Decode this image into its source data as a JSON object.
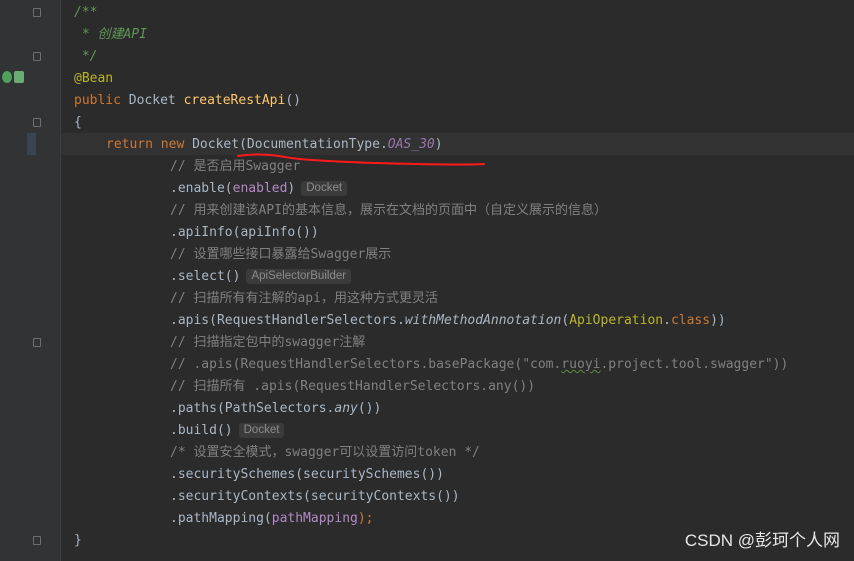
{
  "code": {
    "doc_open": "/**",
    "doc_body": " * 创建API",
    "doc_close": " */",
    "annotation": "@Bean",
    "sig_kw": "public ",
    "sig_type": "Docket ",
    "sig_fn": "createRestApi",
    "sig_paren": "()",
    "brace_open": "{",
    "ret_kw1": "return ",
    "ret_kw2": "new ",
    "ret_call": "Docket(DocumentationType.",
    "ret_const": "OAS_30",
    "ret_close": ")",
    "c1": "// 是否启用Swagger",
    "enable_a": ".enable(",
    "enable_p": "enabled",
    "enable_b": ")",
    "enable_hint": "Docket",
    "c2": "// 用来创建该API的基本信息，展示在文档的页面中（自定义展示的信息）",
    "apiinfo": ".apiInfo(apiInfo())",
    "c3": "// 设置哪些接口暴露给Swagger展示",
    "select": ".select()",
    "select_hint": "ApiSelectorBuilder",
    "c4": "// 扫描所有有注解的api，用这种方式更灵活",
    "apis_a": ".apis(RequestHandlerSelectors.",
    "apis_fn": "withMethodAnnotation",
    "apis_b": "(",
    "apis_cls": "ApiOperation",
    "apis_dot": ".",
    "apis_kw": "class",
    "apis_c": "))",
    "c5": "// 扫描指定包中的swagger注解",
    "c6_a": "// .apis(RequestHandlerSelectors.basePackage(\"com.",
    "c6_sq": "ruoyi",
    "c6_b": ".project.tool.swagger\"))",
    "c7": "// 扫描所有 .apis(RequestHandlerSelectors.any())",
    "paths_a": ".paths(PathSelectors.",
    "paths_fn": "any",
    "paths_b": "())",
    "build": ".build()",
    "build_hint": "Docket",
    "c8": "/* 设置安全模式，swagger可以设置访问token */",
    "security_schemes": ".securitySchemes(securitySchemes())",
    "security_contexts": ".securityContexts(securityContexts())",
    "pm_a": ".pathMapping(",
    "pm_p": "pathMapping",
    "pm_b": ");",
    "brace_close": "}"
  },
  "watermark": "CSDN @彭珂个人网",
  "colors": {
    "background": "#2b2b2b",
    "gutter": "#313335",
    "keyword": "#cc7832",
    "function": "#ffc66d",
    "annotation": "#bbb529",
    "comment": "#808080",
    "doc_comment": "#629755",
    "constant": "#9876aa",
    "annotation_mark": "#ff0000"
  }
}
